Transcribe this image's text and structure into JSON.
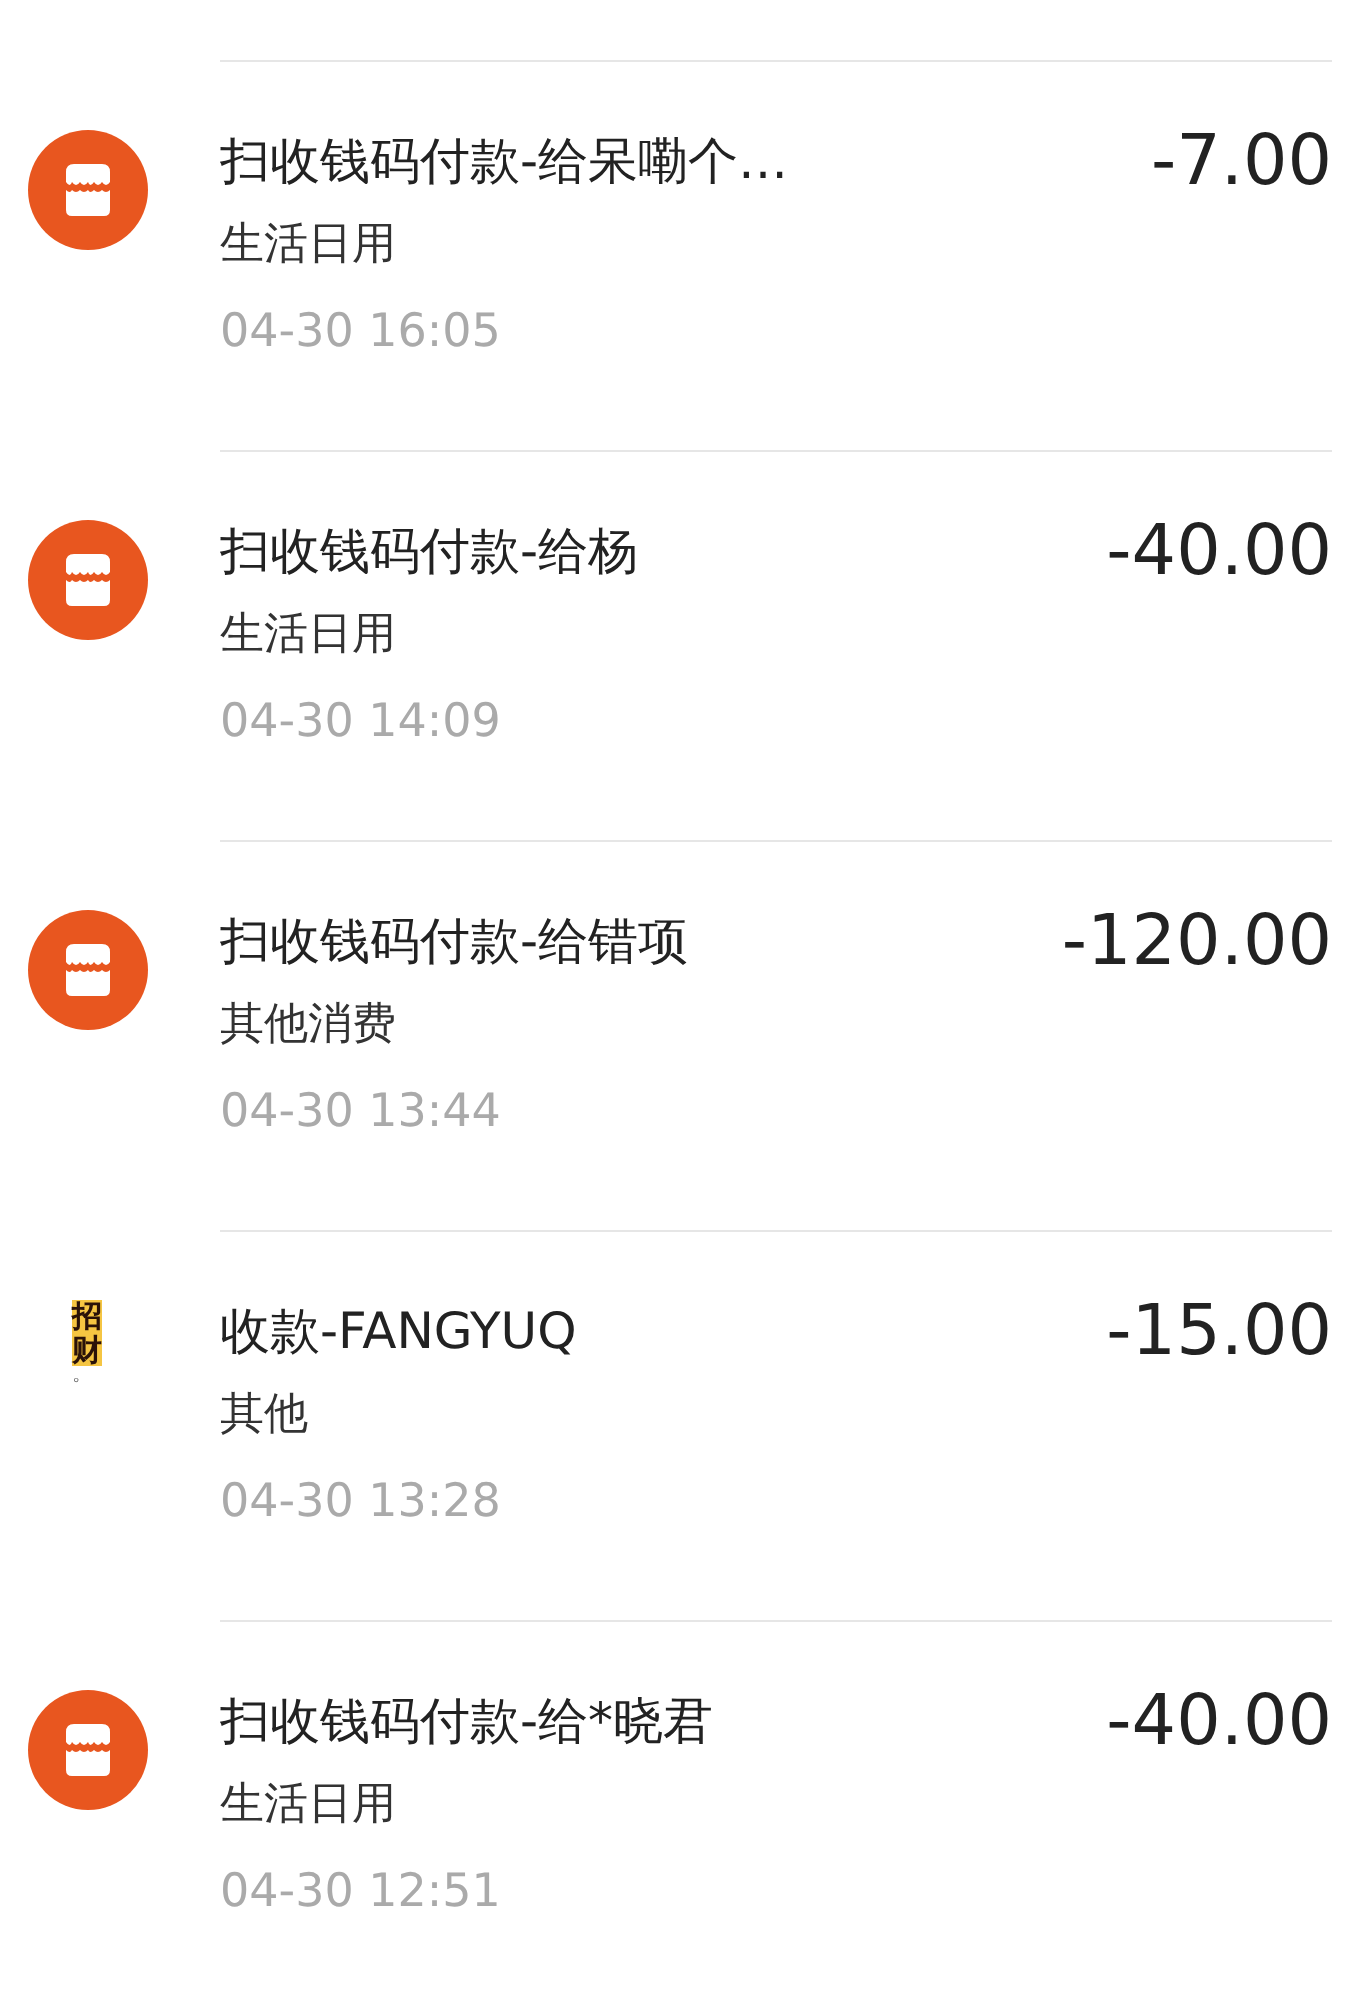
{
  "transactions": [
    {
      "icon": {
        "kind": "store"
      },
      "title": "扫收钱码付款-给呆嘞个…",
      "category": "生活日用",
      "time": "04-30  16:05",
      "amount": "-7.00"
    },
    {
      "icon": {
        "kind": "store"
      },
      "title": "扫收钱码付款-给杨",
      "category": "生活日用",
      "time": "04-30  14:09",
      "amount": "-40.00"
    },
    {
      "icon": {
        "kind": "store"
      },
      "title": "扫收钱码付款-给错项",
      "category": "其他消费",
      "time": "04-30  13:44",
      "amount": "-120.00"
    },
    {
      "icon": {
        "kind": "text-avatar",
        "text": "招财",
        "mark": "。"
      },
      "title": "收款-FANGYUQ",
      "category": "其他",
      "time": "04-30  13:28",
      "amount": "-15.00"
    },
    {
      "icon": {
        "kind": "store"
      },
      "title": "扫收钱码付款-给*晓君",
      "category": "生活日用",
      "time": "04-30  12:51",
      "amount": "-40.00"
    }
  ]
}
